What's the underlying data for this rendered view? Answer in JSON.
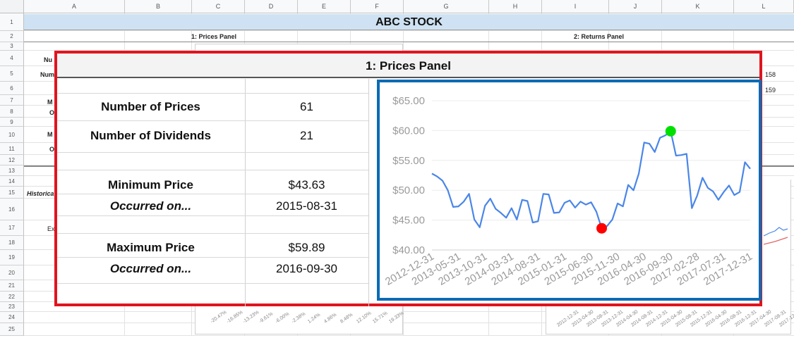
{
  "sheet": {
    "title": "ABC STOCK",
    "columns": [
      "A",
      "B",
      "C",
      "D",
      "E",
      "F",
      "G",
      "H",
      "I",
      "J",
      "K",
      "L"
    ],
    "rows": [
      "1",
      "2",
      "3",
      "4",
      "5",
      "6",
      "7",
      "8",
      "9",
      "10",
      "11",
      "12",
      "13",
      "14",
      "15",
      "16",
      "17",
      "18",
      "19",
      "20",
      "21",
      "22",
      "23",
      "24",
      "25"
    ],
    "panel1_header": "1: Prices Panel",
    "panel2_header": "2: Returns Panel",
    "bg_fragments": {
      "r4": "Nu",
      "r5": "Num",
      "r7": "M",
      "r8": "O",
      "r10": "M",
      "r11": "O",
      "r15": "Historica",
      "r17": "Ex",
      "k5": "158",
      "k6": "159"
    },
    "bg_hist_ticks": [
      "-20.47%",
      "-16.85%",
      "-13.23%",
      "-9.61%",
      "-6.00%",
      "-2.38%",
      "1.24%",
      "4.86%",
      "8.48%",
      "12.10%",
      "15.71%",
      "19.33%"
    ],
    "bg_returns_ticks": [
      "2012-12-31",
      "2013-04-30",
      "2013-08-31",
      "2013-12-31",
      "2014-04-30",
      "2014-08-31",
      "2014-12-31",
      "2015-04-30",
      "2015-08-31",
      "2015-12-31",
      "2016-04-30",
      "2016-08-31",
      "2016-12-31",
      "2017-04-30",
      "2017-08-31",
      "2017-12-31"
    ]
  },
  "panel": {
    "title": "1: Prices Panel",
    "stats": [
      {
        "label": "Number of Prices",
        "value": "61",
        "italic": false
      },
      {
        "label": "Number of Dividends",
        "value": "21",
        "italic": false
      },
      {
        "label": "Minimum Price",
        "value": "$43.63",
        "italic": false
      },
      {
        "label": "Occurred on...",
        "value": "2015-08-31",
        "italic": true
      },
      {
        "label": "Maximum Price",
        "value": "$59.89",
        "italic": false
      },
      {
        "label": "Occurred on...",
        "value": "2016-09-30",
        "italic": true
      }
    ]
  },
  "chart_data": {
    "type": "line",
    "title": "",
    "xlabel": "",
    "ylabel": "",
    "ylim": [
      40,
      65
    ],
    "yticks": [
      40,
      45,
      50,
      55,
      60,
      65
    ],
    "ytick_labels": [
      "$40.00",
      "$45.00",
      "$50.00",
      "$55.00",
      "$60.00",
      "$65.00"
    ],
    "xtick_labels": [
      "2012-12-31",
      "2013-05-31",
      "2013-10-31",
      "2014-03-31",
      "2014-08-31",
      "2015-01-31",
      "2015-06-30",
      "2015-11-30",
      "2016-04-30",
      "2016-09-30",
      "2017-02-28",
      "2017-07-31",
      "2017-12-31"
    ],
    "grid": true,
    "line_color": "#4a86e8",
    "min_marker_color": "#ff0000",
    "max_marker_color": "#00e000",
    "min_index": 32,
    "max_index": 45,
    "series": [
      {
        "values": [
          52.8,
          52.3,
          51.6,
          50.0,
          47.2,
          47.3,
          48.1,
          49.4,
          45.1,
          43.8,
          47.4,
          48.6,
          46.9,
          46.2,
          45.4,
          47.0,
          45.1,
          48.4,
          48.2,
          44.6,
          44.8,
          49.4,
          49.3,
          46.2,
          46.3,
          47.9,
          48.3,
          47.1,
          48.1,
          47.6,
          48.0,
          46.4,
          43.63,
          44.0,
          45.1,
          47.8,
          47.3,
          50.9,
          50.0,
          52.8,
          58.0,
          57.8,
          56.4,
          58.8,
          59.2,
          59.89,
          55.8,
          55.9,
          56.1,
          47.0,
          49.1,
          52.1,
          50.4,
          49.8,
          48.4,
          49.7,
          50.8,
          49.2,
          49.7,
          54.7,
          53.6
        ]
      }
    ]
  }
}
